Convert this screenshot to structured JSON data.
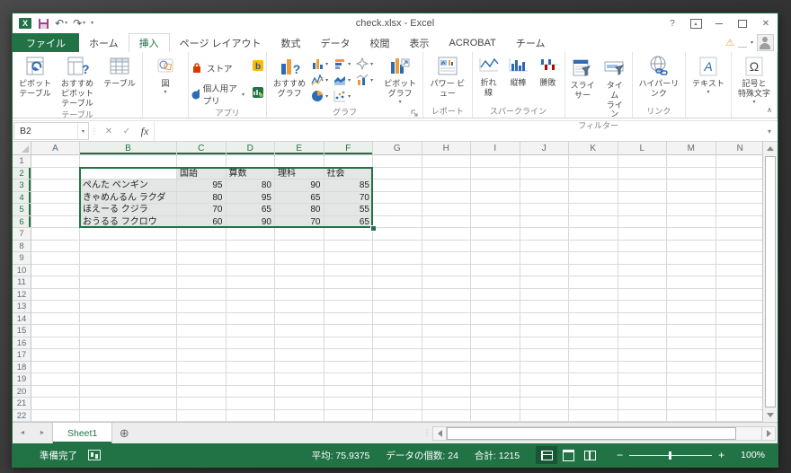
{
  "window": {
    "title": "check.xlsx - Excel"
  },
  "tabs": {
    "items": [
      "ファイル",
      "ホーム",
      "挿入",
      "ページ レイアウト",
      "数式",
      "データ",
      "校閲",
      "表示",
      "ACROBAT",
      "チーム"
    ],
    "active": "挿入"
  },
  "ribbon": {
    "pivot_table": "ピボット\nテーブル",
    "recommended_pivot": "おすすめ\nピボットテーブル",
    "table": "テーブル",
    "tables_group": "テーブル",
    "illustrations": "図",
    "store": "ストア",
    "my_apps": "個人用アプリ",
    "apps_group": "アプリ",
    "recommended_charts": "おすすめ\nグラフ",
    "pivot_chart": "ピボットグラフ",
    "charts_group": "グラフ",
    "power_view": "パワー ビュー",
    "reports_group": "レポート",
    "spark_line": "折れ線",
    "spark_column": "縦棒",
    "spark_winloss": "勝敗",
    "sparklines_group": "スパークライン",
    "slicer": "スライサー",
    "timeline": "タイム\nライン",
    "filters_group": "フィルター",
    "hyperlink": "ハイパーリンク",
    "links_group": "リンク",
    "text": "テキスト",
    "symbols": "記号と\n特殊文字"
  },
  "formula_bar": {
    "name_box": "B2",
    "formula": ""
  },
  "sheet": {
    "columns": [
      "A",
      "B",
      "C",
      "D",
      "E",
      "F",
      "G",
      "H",
      "I",
      "J",
      "K",
      "L",
      "M",
      "N"
    ],
    "row_count": 22,
    "cells": {
      "C2": "国語",
      "D2": "算数",
      "E2": "理科",
      "F2": "社会",
      "B3": "ぺんた ペンギン",
      "C3": "95",
      "D3": "80",
      "E3": "90",
      "F3": "85",
      "B4": "きゃめんるん ラクダ",
      "C4": "80",
      "D4": "95",
      "E4": "65",
      "F4": "70",
      "B5": "ほえーる クジラ",
      "C5": "70",
      "D5": "65",
      "E5": "80",
      "F5": "55",
      "B6": "おうるる フクロウ",
      "C6": "60",
      "D6": "90",
      "E6": "70",
      "F6": "65"
    },
    "selection": {
      "range": "B2:F6",
      "active": "B2"
    }
  },
  "sheet_tabs": {
    "sheet1": "Sheet1"
  },
  "status_bar": {
    "mode": "準備完了",
    "average": "平均: 75.9375",
    "count": "データの個数: 24",
    "sum": "合計: 1215",
    "zoom_level": "100%"
  },
  "colors": {
    "accent_green": "#217346",
    "selection_fill": "#E3E6E4",
    "warning": "#E8A33D"
  },
  "icons": {
    "logo_x": "X",
    "undo": "↶",
    "redo": "↷",
    "dropdown": "▾",
    "help": "?",
    "close": "✕",
    "warning": "⚠",
    "underscore": "＿",
    "question": "?",
    "bing_b": "b",
    "text_a": "A",
    "omega": "Ω",
    "fx": "fx",
    "cancel": "✕",
    "enter": "✓",
    "divider": "⋮",
    "tab_nav_left": "◄",
    "tab_nav_right": "►",
    "add_sheet": "⊕",
    "collapse": "∧",
    "minus": "−",
    "plus": "+"
  }
}
